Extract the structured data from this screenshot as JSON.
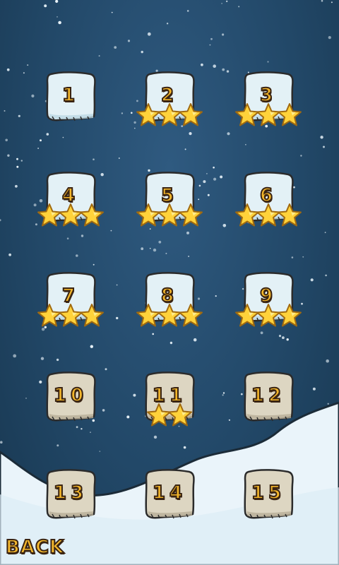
{
  "levels": [
    {
      "label": "1",
      "stars": 0,
      "state": "unlocked"
    },
    {
      "label": "2",
      "stars": 3,
      "state": "unlocked"
    },
    {
      "label": "3",
      "stars": 3,
      "state": "unlocked"
    },
    {
      "label": "4",
      "stars": 3,
      "state": "unlocked"
    },
    {
      "label": "5",
      "stars": 3,
      "state": "unlocked"
    },
    {
      "label": "6",
      "stars": 3,
      "state": "unlocked"
    },
    {
      "label": "7",
      "stars": 3,
      "state": "unlocked"
    },
    {
      "label": "8",
      "stars": 3,
      "state": "unlocked"
    },
    {
      "label": "9",
      "stars": 3,
      "state": "unlocked"
    },
    {
      "label": "10",
      "stars": 0,
      "state": "locked"
    },
    {
      "label": "11",
      "stars": 2,
      "state": "locked"
    },
    {
      "label": "12",
      "stars": 0,
      "state": "locked"
    },
    {
      "label": "13",
      "stars": 0,
      "state": "locked"
    },
    {
      "label": "14",
      "stars": 0,
      "state": "locked"
    },
    {
      "label": "15",
      "stars": 0,
      "state": "locked"
    }
  ],
  "back_label": "BACK",
  "colors": {
    "sky": "#224868",
    "ice_tile": "#e3f1f6",
    "stone_tile": "#ddd6c2",
    "number": "#f3b62b",
    "star": "#ffd23a",
    "outline": "#3a2412",
    "snow": "#eaf4fa"
  }
}
